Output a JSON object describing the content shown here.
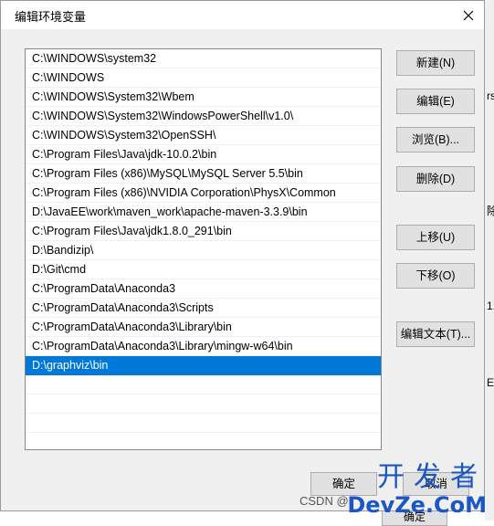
{
  "dialog": {
    "title": "编辑环境变量"
  },
  "paths": [
    "C:\\WINDOWS\\system32",
    "C:\\WINDOWS",
    "C:\\WINDOWS\\System32\\Wbem",
    "C:\\WINDOWS\\System32\\WindowsPowerShell\\v1.0\\",
    "C:\\WINDOWS\\System32\\OpenSSH\\",
    "C:\\Program Files\\Java\\jdk-10.0.2\\bin",
    "C:\\Program Files (x86)\\MySQL\\MySQL Server 5.5\\bin",
    "C:\\Program Files (x86)\\NVIDIA Corporation\\PhysX\\Common",
    "D:\\JavaEE\\work\\maven_work\\apache-maven-3.3.9\\bin",
    "C:\\Program Files\\Java\\jdk1.8.0_291\\bin",
    "D:\\Bandizip\\",
    "D:\\Git\\cmd",
    "C:\\ProgramData\\Anaconda3",
    "C:\\ProgramData\\Anaconda3\\Scripts",
    "C:\\ProgramData\\Anaconda3\\Library\\bin",
    "C:\\ProgramData\\Anaconda3\\Library\\mingw-w64\\bin",
    "D:\\graphviz\\bin"
  ],
  "selected_index": 16,
  "buttons": {
    "new": "新建(N)",
    "edit": "编辑(E)",
    "browse": "浏览(B)...",
    "delete": "删除(D)",
    "move_up": "上移(U)",
    "move_down": "下移(O)",
    "edit_text": "编辑文本(T)..."
  },
  "footer": {
    "ok": "确定",
    "cancel": "取消"
  },
  "background_fragments": {
    "frag1": "rs",
    "frag2": "除",
    "frag3": "1.",
    "frag4": "E",
    "bottom_button": "确定"
  },
  "watermark": {
    "top": "开发者",
    "bottom": "DevZe.CoM",
    "csdn": "CSDN @"
  },
  "colors": {
    "selection": "#0078d7",
    "button_face": "#e1e1e1",
    "button_border": "#adadad",
    "watermark": "#1a56c4"
  }
}
